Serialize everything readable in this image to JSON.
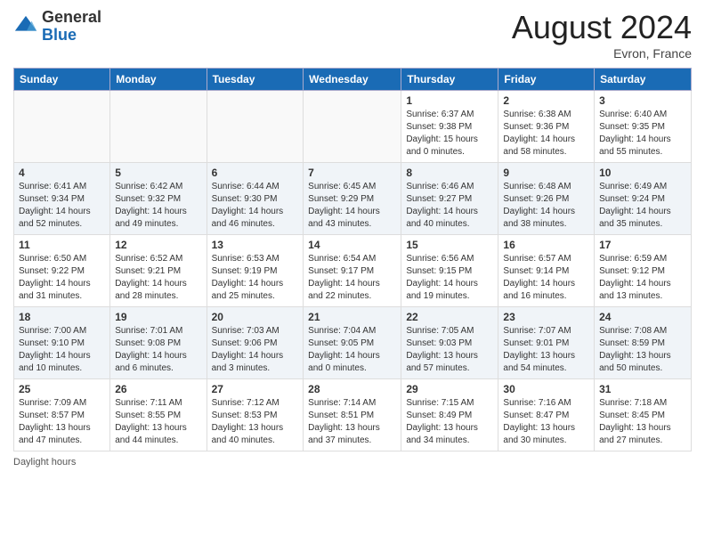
{
  "header": {
    "logo_general": "General",
    "logo_blue": "Blue",
    "month_year": "August 2024",
    "location": "Evron, France"
  },
  "days_of_week": [
    "Sunday",
    "Monday",
    "Tuesday",
    "Wednesday",
    "Thursday",
    "Friday",
    "Saturday"
  ],
  "weeks": [
    [
      {
        "day": "",
        "info": ""
      },
      {
        "day": "",
        "info": ""
      },
      {
        "day": "",
        "info": ""
      },
      {
        "day": "",
        "info": ""
      },
      {
        "day": "1",
        "info": "Sunrise: 6:37 AM\nSunset: 9:38 PM\nDaylight: 15 hours\nand 0 minutes."
      },
      {
        "day": "2",
        "info": "Sunrise: 6:38 AM\nSunset: 9:36 PM\nDaylight: 14 hours\nand 58 minutes."
      },
      {
        "day": "3",
        "info": "Sunrise: 6:40 AM\nSunset: 9:35 PM\nDaylight: 14 hours\nand 55 minutes."
      }
    ],
    [
      {
        "day": "4",
        "info": "Sunrise: 6:41 AM\nSunset: 9:34 PM\nDaylight: 14 hours\nand 52 minutes."
      },
      {
        "day": "5",
        "info": "Sunrise: 6:42 AM\nSunset: 9:32 PM\nDaylight: 14 hours\nand 49 minutes."
      },
      {
        "day": "6",
        "info": "Sunrise: 6:44 AM\nSunset: 9:30 PM\nDaylight: 14 hours\nand 46 minutes."
      },
      {
        "day": "7",
        "info": "Sunrise: 6:45 AM\nSunset: 9:29 PM\nDaylight: 14 hours\nand 43 minutes."
      },
      {
        "day": "8",
        "info": "Sunrise: 6:46 AM\nSunset: 9:27 PM\nDaylight: 14 hours\nand 40 minutes."
      },
      {
        "day": "9",
        "info": "Sunrise: 6:48 AM\nSunset: 9:26 PM\nDaylight: 14 hours\nand 38 minutes."
      },
      {
        "day": "10",
        "info": "Sunrise: 6:49 AM\nSunset: 9:24 PM\nDaylight: 14 hours\nand 35 minutes."
      }
    ],
    [
      {
        "day": "11",
        "info": "Sunrise: 6:50 AM\nSunset: 9:22 PM\nDaylight: 14 hours\nand 31 minutes."
      },
      {
        "day": "12",
        "info": "Sunrise: 6:52 AM\nSunset: 9:21 PM\nDaylight: 14 hours\nand 28 minutes."
      },
      {
        "day": "13",
        "info": "Sunrise: 6:53 AM\nSunset: 9:19 PM\nDaylight: 14 hours\nand 25 minutes."
      },
      {
        "day": "14",
        "info": "Sunrise: 6:54 AM\nSunset: 9:17 PM\nDaylight: 14 hours\nand 22 minutes."
      },
      {
        "day": "15",
        "info": "Sunrise: 6:56 AM\nSunset: 9:15 PM\nDaylight: 14 hours\nand 19 minutes."
      },
      {
        "day": "16",
        "info": "Sunrise: 6:57 AM\nSunset: 9:14 PM\nDaylight: 14 hours\nand 16 minutes."
      },
      {
        "day": "17",
        "info": "Sunrise: 6:59 AM\nSunset: 9:12 PM\nDaylight: 14 hours\nand 13 minutes."
      }
    ],
    [
      {
        "day": "18",
        "info": "Sunrise: 7:00 AM\nSunset: 9:10 PM\nDaylight: 14 hours\nand 10 minutes."
      },
      {
        "day": "19",
        "info": "Sunrise: 7:01 AM\nSunset: 9:08 PM\nDaylight: 14 hours\nand 6 minutes."
      },
      {
        "day": "20",
        "info": "Sunrise: 7:03 AM\nSunset: 9:06 PM\nDaylight: 14 hours\nand 3 minutes."
      },
      {
        "day": "21",
        "info": "Sunrise: 7:04 AM\nSunset: 9:05 PM\nDaylight: 14 hours\nand 0 minutes."
      },
      {
        "day": "22",
        "info": "Sunrise: 7:05 AM\nSunset: 9:03 PM\nDaylight: 13 hours\nand 57 minutes."
      },
      {
        "day": "23",
        "info": "Sunrise: 7:07 AM\nSunset: 9:01 PM\nDaylight: 13 hours\nand 54 minutes."
      },
      {
        "day": "24",
        "info": "Sunrise: 7:08 AM\nSunset: 8:59 PM\nDaylight: 13 hours\nand 50 minutes."
      }
    ],
    [
      {
        "day": "25",
        "info": "Sunrise: 7:09 AM\nSunset: 8:57 PM\nDaylight: 13 hours\nand 47 minutes."
      },
      {
        "day": "26",
        "info": "Sunrise: 7:11 AM\nSunset: 8:55 PM\nDaylight: 13 hours\nand 44 minutes."
      },
      {
        "day": "27",
        "info": "Sunrise: 7:12 AM\nSunset: 8:53 PM\nDaylight: 13 hours\nand 40 minutes."
      },
      {
        "day": "28",
        "info": "Sunrise: 7:14 AM\nSunset: 8:51 PM\nDaylight: 13 hours\nand 37 minutes."
      },
      {
        "day": "29",
        "info": "Sunrise: 7:15 AM\nSunset: 8:49 PM\nDaylight: 13 hours\nand 34 minutes."
      },
      {
        "day": "30",
        "info": "Sunrise: 7:16 AM\nSunset: 8:47 PM\nDaylight: 13 hours\nand 30 minutes."
      },
      {
        "day": "31",
        "info": "Sunrise: 7:18 AM\nSunset: 8:45 PM\nDaylight: 13 hours\nand 27 minutes."
      }
    ]
  ],
  "footer": {
    "note": "Daylight hours"
  }
}
